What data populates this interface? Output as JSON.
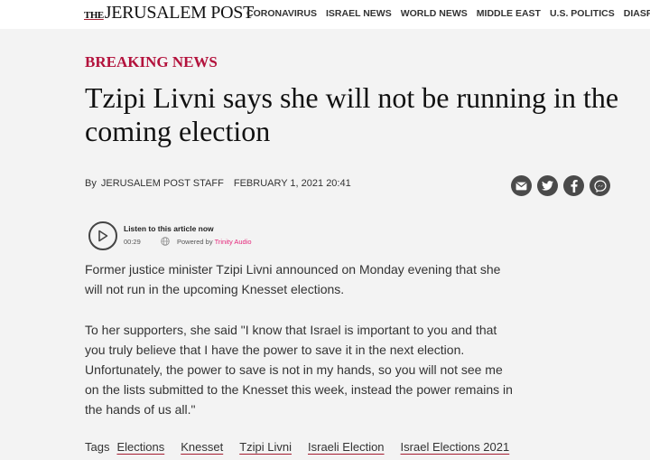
{
  "header": {
    "logo_the": "THE",
    "logo_name": "JERUSALEM POST",
    "nav": [
      "CORONAVIRUS",
      "ISRAEL NEWS",
      "WORLD NEWS",
      "MIDDLE EAST",
      "U.S. POLITICS",
      "DIASPORA"
    ]
  },
  "article": {
    "kicker": "BREAKING NEWS",
    "headline": "Tzipi Livni says she will not be running in the coming election",
    "byline_prefix": "By",
    "author": "JERUSALEM POST STAFF",
    "date": "FEBRUARY 1, 2021 20:41",
    "share_icons": [
      "email-icon",
      "twitter-icon",
      "facebook-icon",
      "messenger-icon"
    ],
    "audio": {
      "title": "Listen to this article now",
      "duration": "00:29",
      "powered_by": "Powered by",
      "brand": "Trinity Audio"
    },
    "paragraphs": [
      "Former justice minister Tzipi Livni announced on Monday evening that she will not run in the upcoming Knesset elections.",
      "To her supporters, she said \"I know that Israel is important to you and that you truly believe that I have the power to save it in the next election. Unfortunately, the power to save is not in my hands,  so you will not see me on the lists submitted to the Knesset this week, instead the power remains in the hands of us all.\""
    ],
    "tags_label": "Tags",
    "tags": [
      "Elections",
      "Knesset",
      "Tzipi Livni",
      "Israeli Election",
      "Israel Elections 2021"
    ]
  },
  "colors": {
    "accent": "#b3123c",
    "icon_bg": "#4a4a4a",
    "brand_pink": "#e5267a"
  }
}
